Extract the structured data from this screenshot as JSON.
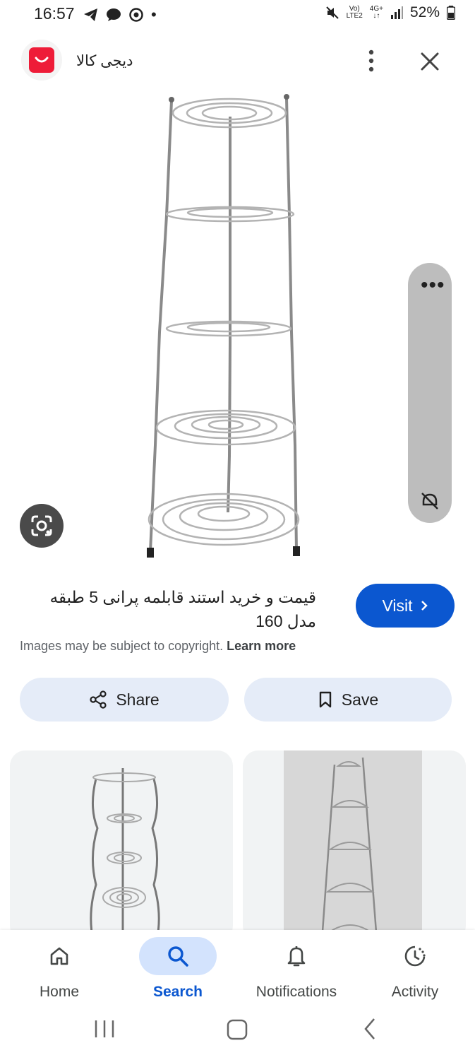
{
  "status_bar": {
    "time": "16:57",
    "battery": "52%",
    "network_top": "4G+",
    "volte_top": "Vo)",
    "volte_bottom": "LTE2"
  },
  "header": {
    "site_name": "دیجی کالا",
    "logo_color": "#ee1c38"
  },
  "result": {
    "title_line1": "قیمت و خرید استند قابلمه پرانی 5 طبقه",
    "title_line2": "مدل 160",
    "visit_label": "Visit",
    "copyright_text": "Images may be subject to copyright.",
    "learn_more": "Learn more"
  },
  "actions": {
    "share_label": "Share",
    "save_label": "Save"
  },
  "bottom_nav": {
    "items": [
      {
        "label": "Home",
        "icon": "home-icon"
      },
      {
        "label": "Search",
        "icon": "search-icon",
        "active": true
      },
      {
        "label": "Notifications",
        "icon": "bell-icon"
      },
      {
        "label": "Activity",
        "icon": "activity-icon"
      }
    ]
  },
  "colors": {
    "accent": "#0b57d0",
    "pill_bg": "#e5ecf8",
    "active_nav_bg": "#d3e3fd"
  }
}
